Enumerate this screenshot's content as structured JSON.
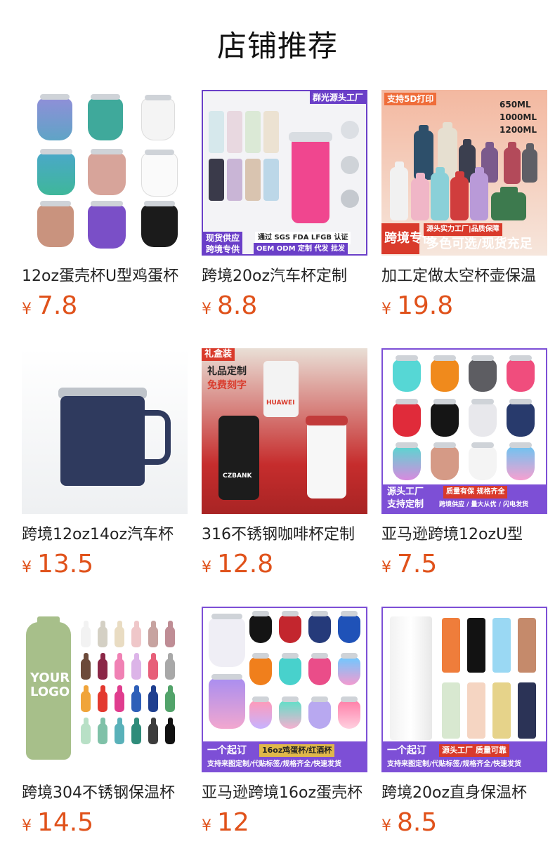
{
  "page": {
    "title": "店铺推荐"
  },
  "products": [
    {
      "name": "12oz蛋壳杯U型鸡蛋杯",
      "yen": "¥",
      "price": "7.8"
    },
    {
      "name": "跨境20oz汽车杯定制",
      "yen": "¥",
      "price": "8.8"
    },
    {
      "name": "加工定做太空杯壶保温",
      "yen": "¥",
      "price": "19.8"
    },
    {
      "name": "跨境12oz14oz汽车杯",
      "yen": "¥",
      "price": "13.5"
    },
    {
      "name": "316不锈钢咖啡杯定制",
      "yen": "¥",
      "price": "12.8"
    },
    {
      "name": "亚马逊跨境12ozU型",
      "yen": "¥",
      "price": "7.5"
    },
    {
      "name": "跨境304不锈钢保温杯",
      "yen": "¥",
      "price": "14.5"
    },
    {
      "name": "亚马逊跨境16oz蛋壳杯",
      "yen": "¥",
      "price": "12"
    },
    {
      "name": "跨境20oz直身保温杯",
      "yen": "¥",
      "price": "8.5"
    }
  ],
  "thumb_text": {
    "p2_top": "群光源头工厂",
    "p2_left1": "现货供应",
    "p2_left2": "跨境专供",
    "p2_right1": "通过 SGS FDA LFGB 认证",
    "p2_right2": "OEM ODM 定制 代发 批发",
    "p3_top": "支持5D打印",
    "p3_sizes": [
      "650ML",
      "1000ML",
      "1200ML"
    ],
    "p3_left": "跨境专供",
    "p3_r1": "源头实力工厂|品质保障",
    "p3_r2": "多色可选/现货充足",
    "p5_tag": "礼盒装",
    "p5_l1": "礼品定制",
    "p5_l2": "免费刻字",
    "p5_brand": "HUAWEI",
    "p5_bank": "CZBANK",
    "p6_l1": "源头工厂",
    "p6_l2": "支持定制",
    "p6_r1": "质量有保 规格齐全",
    "p6_r2": "跨境供应 / 量大从优 / 闪电发货",
    "p7_logo1": "YOUR",
    "p7_logo2": "LOGO",
    "p8_l": "一个起订",
    "p8_r": "16oz鸡蛋杯/红酒杯",
    "p8_b": "支持来图定制/代贴标签/规格齐全/快速发货",
    "p9_l": "一个起订",
    "p9_r": "源头工厂 质量可靠",
    "p9_b": "支持来图定制/代贴标签/规格齐全/快速发货"
  },
  "colors": {
    "price": "#e0521b",
    "purple_banner": "#6a3fc8",
    "red_banner": "#d93a2b"
  }
}
